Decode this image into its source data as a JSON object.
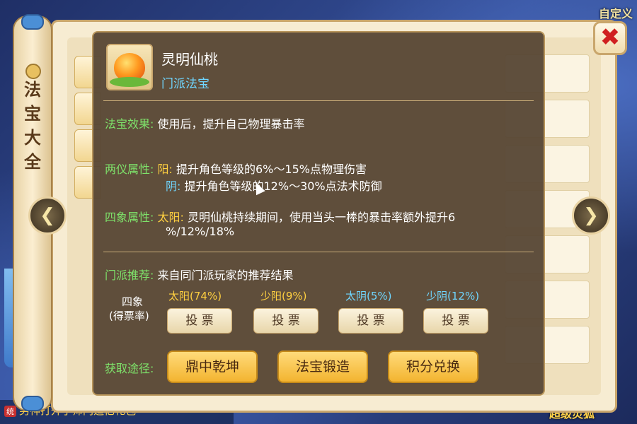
{
  "background": {
    "top_right_text": "自定义",
    "bottom_right_text": "超级灵狐",
    "chat_line": "男神打开了师门追忆礼包"
  },
  "scroll": {
    "title": "法宝大全"
  },
  "close_glyph": "✖",
  "nav": {
    "left_glyph": "❮",
    "right_glyph": "❯"
  },
  "popup": {
    "item_name": "灵明仙桃",
    "item_type": "门派法宝",
    "effect_label": "法宝效果:",
    "effect_text": "使用后，提升自己物理暴击率",
    "liangyi_label": "两仪属性:",
    "yang_label": "阳:",
    "yang_text": "提升角色等级的6%～15%点物理伤害",
    "yin_label": "阴:",
    "yin_text": "提升角色等级的12%～30%点法术防御",
    "sixiang_label": "四象属性:",
    "taiyang_label": "太阳:",
    "taiyang_text_1": "灵明仙桃持续期间，使用当头一棒的暴击率额外提升6",
    "taiyang_text_2": "%/12%/18%",
    "recommend_label": "门派推荐:",
    "recommend_text": "来自同门派玩家的推荐结果",
    "vote_side_label_1": "四象",
    "vote_side_label_2": "(得票率)",
    "votes": [
      {
        "label": "太阳(74%)",
        "color": "#ffd040",
        "button": "投 票"
      },
      {
        "label": "少阳(9%)",
        "color": "#ffd040",
        "button": "投 票"
      },
      {
        "label": "太阴(5%)",
        "color": "#6fd6ff",
        "button": "投 票"
      },
      {
        "label": "少阴(12%)",
        "color": "#6fd6ff",
        "button": "投 票"
      }
    ],
    "acquire_label": "获取途径:",
    "acquire_buttons": [
      "鼎中乾坤",
      "法宝锻造",
      "积分兑换"
    ]
  }
}
